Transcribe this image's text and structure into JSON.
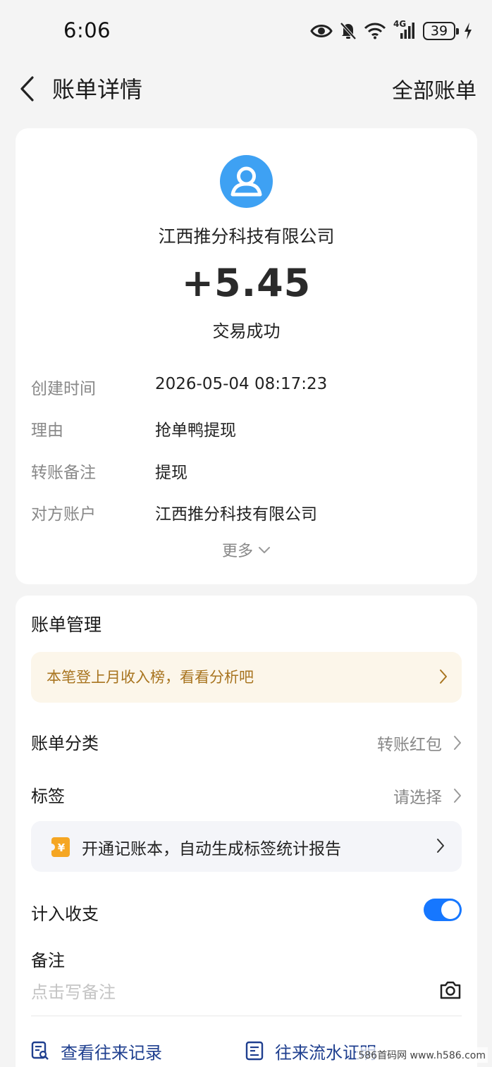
{
  "status_bar": {
    "time": "6:06",
    "network": "4G",
    "battery": "39",
    "icons": [
      "eye-icon",
      "bell-off-icon",
      "wifi-icon",
      "signal-icon",
      "battery-icon",
      "charging-icon"
    ]
  },
  "header": {
    "title": "账单详情",
    "right_action": "全部账单",
    "back_icon": "chevron-left-icon"
  },
  "summary": {
    "avatar_icon": "user-icon",
    "payee": "江西推分科技有限公司",
    "amount": "+5.45",
    "status": "交易成功"
  },
  "details": [
    {
      "label": "创建时间",
      "value": "2026-05-04 08:17:23"
    },
    {
      "label": "理由",
      "value": "抢单鸭提现"
    },
    {
      "label": "转账备注",
      "value": "提现"
    },
    {
      "label": "对方账户",
      "value": "江西推分科技有限公司"
    }
  ],
  "more_label": "更多",
  "management": {
    "title": "账单管理",
    "rank_banner": "本笔登上月收入榜，看看分析吧",
    "category": {
      "label": "账单分类",
      "value": "转账红包"
    },
    "tag": {
      "label": "标签",
      "value": "请选择"
    },
    "book_banner": "开通记账本，自动生成标签统计报告",
    "include": {
      "label": "计入收支",
      "enabled": true
    },
    "note": {
      "label": "备注",
      "placeholder": "点击写备注"
    },
    "links": {
      "history": "查看往来记录",
      "proof": "往来流水证明"
    }
  },
  "watermark": "586首码网 www.h586.com",
  "colors": {
    "accent": "#1677ff",
    "avatar": "#3ea1f3",
    "rank_text": "#a8741f",
    "link": "#1f3f8f"
  }
}
